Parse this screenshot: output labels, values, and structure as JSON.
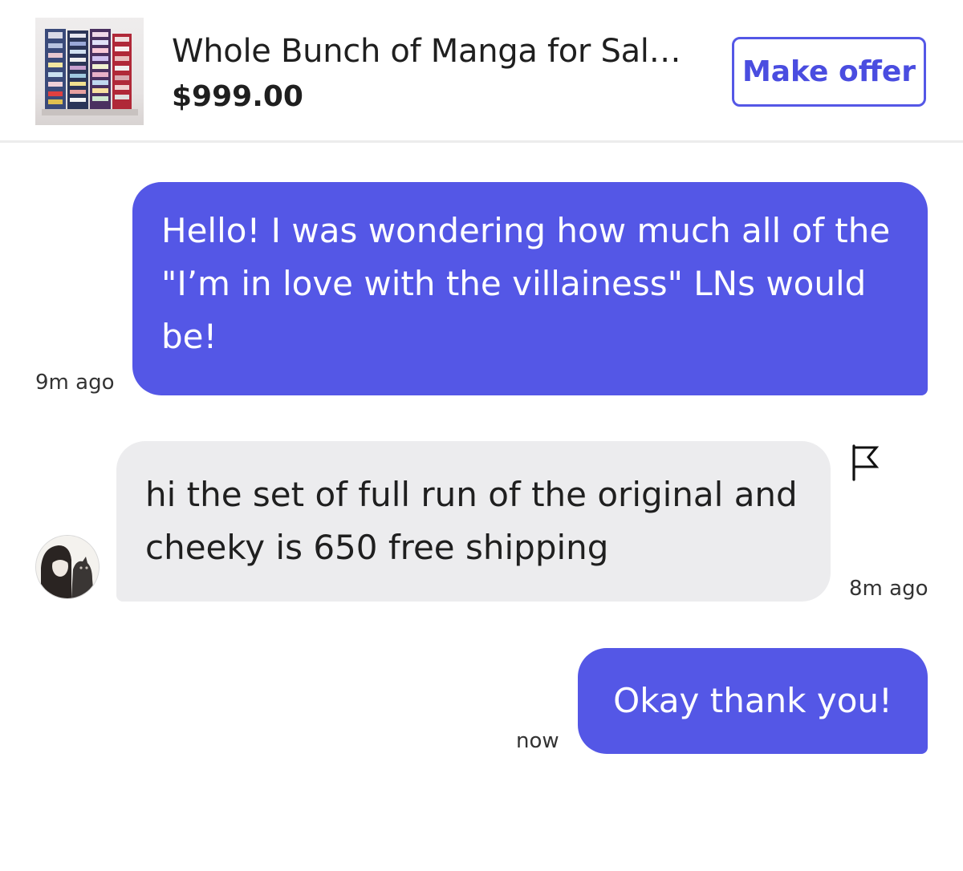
{
  "listing": {
    "title": "Whole Bunch of Manga for Sal…",
    "price": "$999.00",
    "thumbnail_icon": "manga-stack-photo",
    "offer_button_label": "Make offer"
  },
  "colors": {
    "accent": "#5457e6",
    "incoming_bubble": "#ececee",
    "divider": "#ececec"
  },
  "messages": [
    {
      "direction": "outgoing",
      "text": "Hello! I was wondering how much all of the \"I’m in love with the villainess\" LNs would be!",
      "time": "9m ago"
    },
    {
      "direction": "incoming",
      "text": "hi the set of full run of the original and cheeky is 650 free shipping",
      "time": "8m ago",
      "avatar_icon": "user-avatar",
      "action_icon": "report-flag-icon"
    },
    {
      "direction": "outgoing",
      "text": "Okay thank you!",
      "time": "now"
    }
  ]
}
